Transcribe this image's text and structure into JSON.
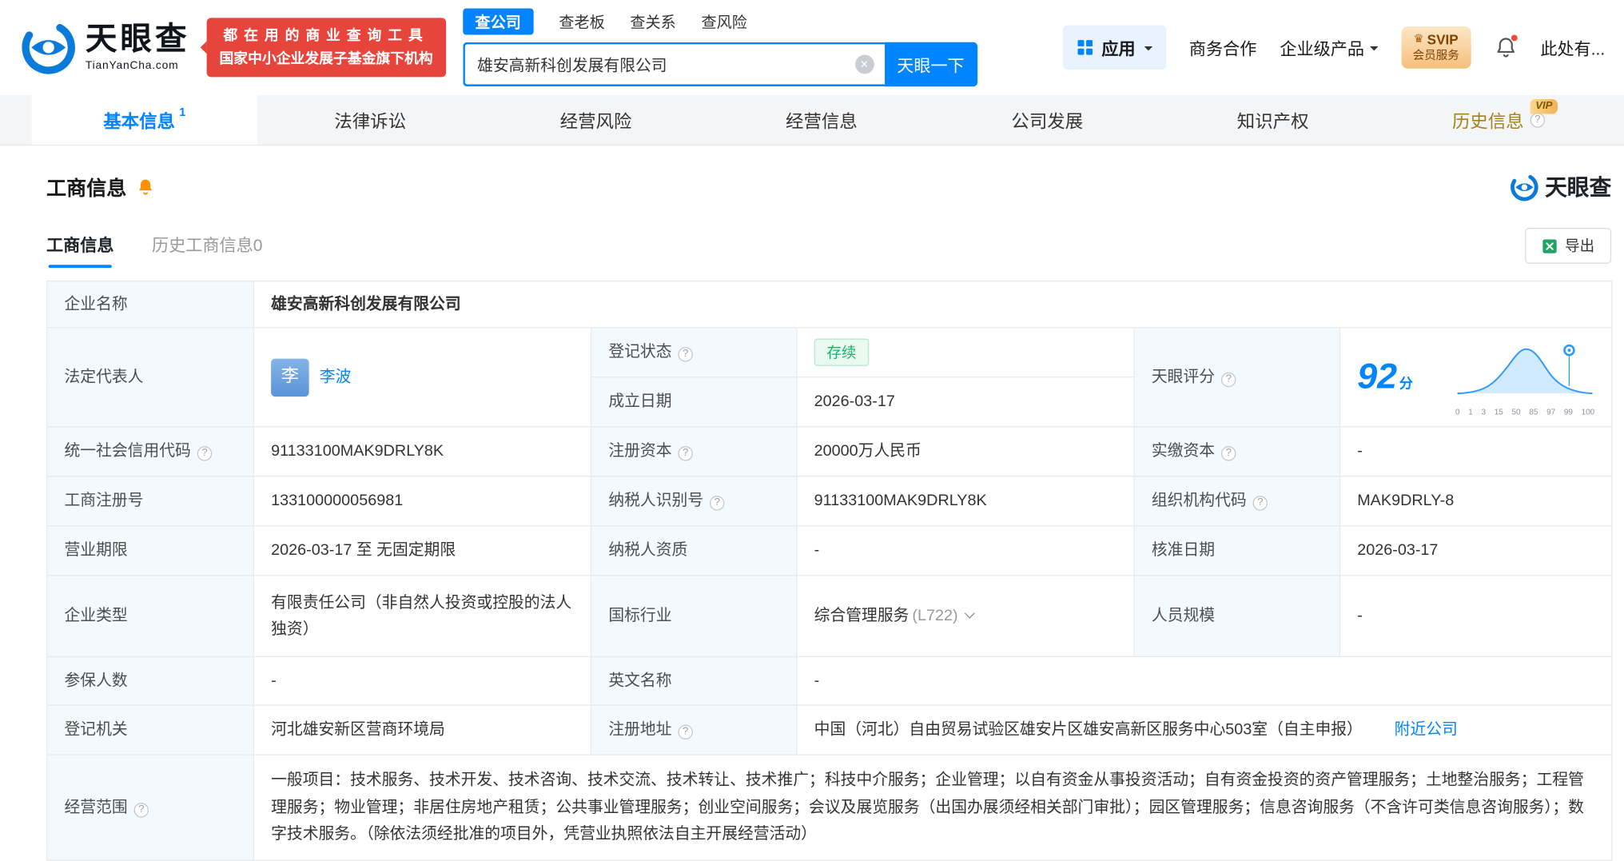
{
  "colors": {
    "brand_blue": "#0084ff",
    "banner_red": "#e7453c",
    "status_green": "#12b364",
    "vip_gold": "#f0b254",
    "label_cell_bg": "#f2f9ff"
  },
  "icons": {
    "help": "?",
    "clear": "×",
    "crown": "♛"
  },
  "header": {
    "brand": "天眼查",
    "brand_domain": "TianYanCha.com",
    "banner_line1": "都在用的商业查询工具",
    "banner_line2": "国家中小企业发展子基金旗下机构",
    "search_tabs": [
      "查公司",
      "查老板",
      "查关系",
      "查风险"
    ],
    "search_value": "雄安高新科创发展有限公司",
    "search_button": "天眼一下",
    "apps_label": "应用",
    "biz_coop": "商务合作",
    "enterprise_product": "企业级产品",
    "svip_line1": "SVIP",
    "svip_line2": "会员服务",
    "more_label": "此处有..."
  },
  "nav": [
    {
      "label": "基本信息",
      "count": "1"
    },
    {
      "label": "法律诉讼"
    },
    {
      "label": "经营风险"
    },
    {
      "label": "经营信息"
    },
    {
      "label": "公司发展"
    },
    {
      "label": "知识产权"
    },
    {
      "label": "历史信息",
      "vip": "VIP"
    }
  ],
  "section": {
    "title": "工商信息",
    "watermark_brand": "天眼查",
    "subtab_active": "工商信息",
    "subtab_history": "历史工商信息0",
    "export_label": "导出"
  },
  "table": {
    "company_name_label": "企业名称",
    "company_name": "雄安高新科创发展有限公司",
    "legal_rep_label": "法定代表人",
    "legal_rep_initial": "李",
    "legal_rep_name": "李波",
    "reg_status_label": "登记状态",
    "reg_status": "存续",
    "score_label": "天眼评分",
    "score_value": "92",
    "score_unit": "分",
    "est_date_label": "成立日期",
    "est_date": "2026-03-17",
    "credit_code_label": "统一社会信用代码",
    "credit_code": "91133100MAK9DRLY8K",
    "reg_capital_label": "注册资本",
    "reg_capital": "20000万人民币",
    "paid_capital_label": "实缴资本",
    "paid_capital": "-",
    "reg_number_label": "工商注册号",
    "reg_number": "133100000056981",
    "taxpayer_id_label": "纳税人识别号",
    "taxpayer_id": "91133100MAK9DRLY8K",
    "org_code_label": "组织机构代码",
    "org_code": "MAK9DRLY-8",
    "business_term_label": "营业期限",
    "business_term": "2026-03-17 至 无固定期限",
    "taxpayer_quality_label": "纳税人资质",
    "taxpayer_quality": "-",
    "approval_date_label": "核准日期",
    "approval_date": "2026-03-17",
    "company_type_label": "企业类型",
    "company_type": "有限责任公司（非自然人投资或控股的法人独资）",
    "industry_label": "国标行业",
    "industry": "综合管理服务",
    "industry_code": "(L722)",
    "staff_size_label": "人员规模",
    "staff_size": "-",
    "insured_label": "参保人数",
    "insured": "-",
    "english_name_label": "英文名称",
    "english_name": "-",
    "reg_authority_label": "登记机关",
    "reg_authority": "河北雄安新区营商环境局",
    "address_label": "注册地址",
    "address": "中国（河北）自由贸易试验区雄安片区雄安高新区服务中心503室（自主申报）",
    "nearby_link": "附近公司",
    "business_scope_label": "经营范围",
    "business_scope": "一般项目：技术服务、技术开发、技术咨询、技术交流、技术转让、技术推广；科技中介服务；企业管理；以自有资金从事投资活动；自有资金投资的资产管理服务；土地整治服务；工程管理服务；物业管理；非居住房地产租赁；公共事业管理服务；创业空间服务；会议及展览服务（出国办展须经相关部门审批）；园区管理服务；信息咨询服务（不含许可类信息咨询服务）；数字技术服务。（除依法须经批准的项目外，凭营业执照依法自主开展经营活动）"
  },
  "score_chart": {
    "type": "area",
    "description": "score-distribution-bell-curve",
    "axis_labels": [
      "0",
      "1",
      "3",
      "15",
      "50",
      "85",
      "97",
      "99",
      "100"
    ]
  }
}
